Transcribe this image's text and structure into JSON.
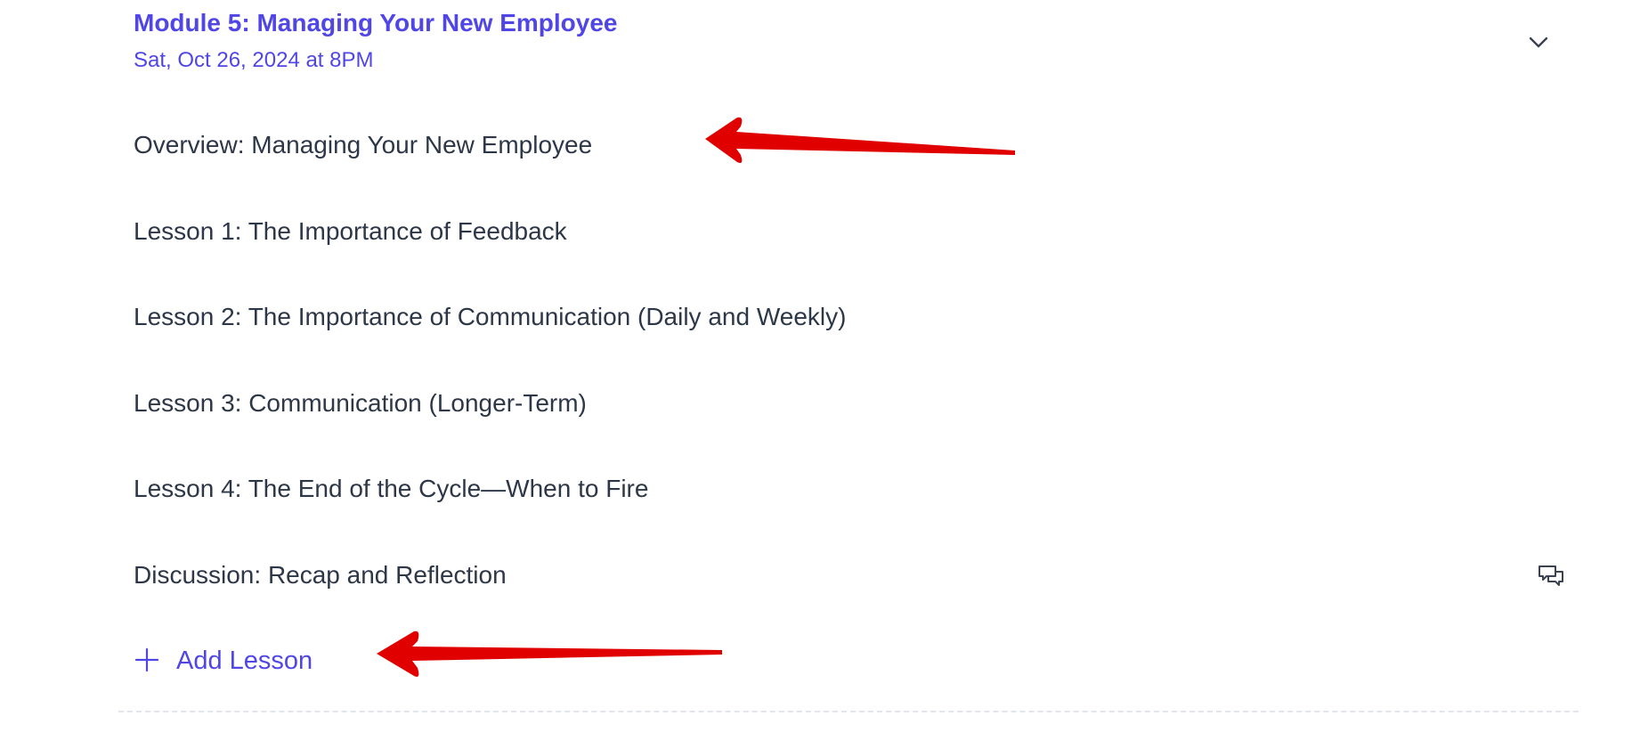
{
  "module": {
    "title": "Module 5: Managing Your New Employee",
    "date": "Sat, Oct 26, 2024 at 8PM"
  },
  "lessons": [
    {
      "label": "Overview: Managing Your New Employee"
    },
    {
      "label": "Lesson 1: The Importance of Feedback"
    },
    {
      "label": "Lesson 2: The Importance of Communication (Daily and Weekly)"
    },
    {
      "label": "Lesson 3: Communication (Longer-Term)"
    },
    {
      "label": "Lesson 4: The End of the Cycle—When to Fire"
    },
    {
      "label": "Discussion: Recap and Reflection",
      "icon": "discussion-icon"
    }
  ],
  "add_lesson": {
    "label": "Add Lesson",
    "icon": "plus-icon"
  },
  "icons": {
    "expand": "chevron-down-icon"
  },
  "colors": {
    "accent": "#5046e5",
    "text": "#2d3748",
    "annotation_arrow": "#e00000",
    "divider": "#e2e5ea"
  }
}
